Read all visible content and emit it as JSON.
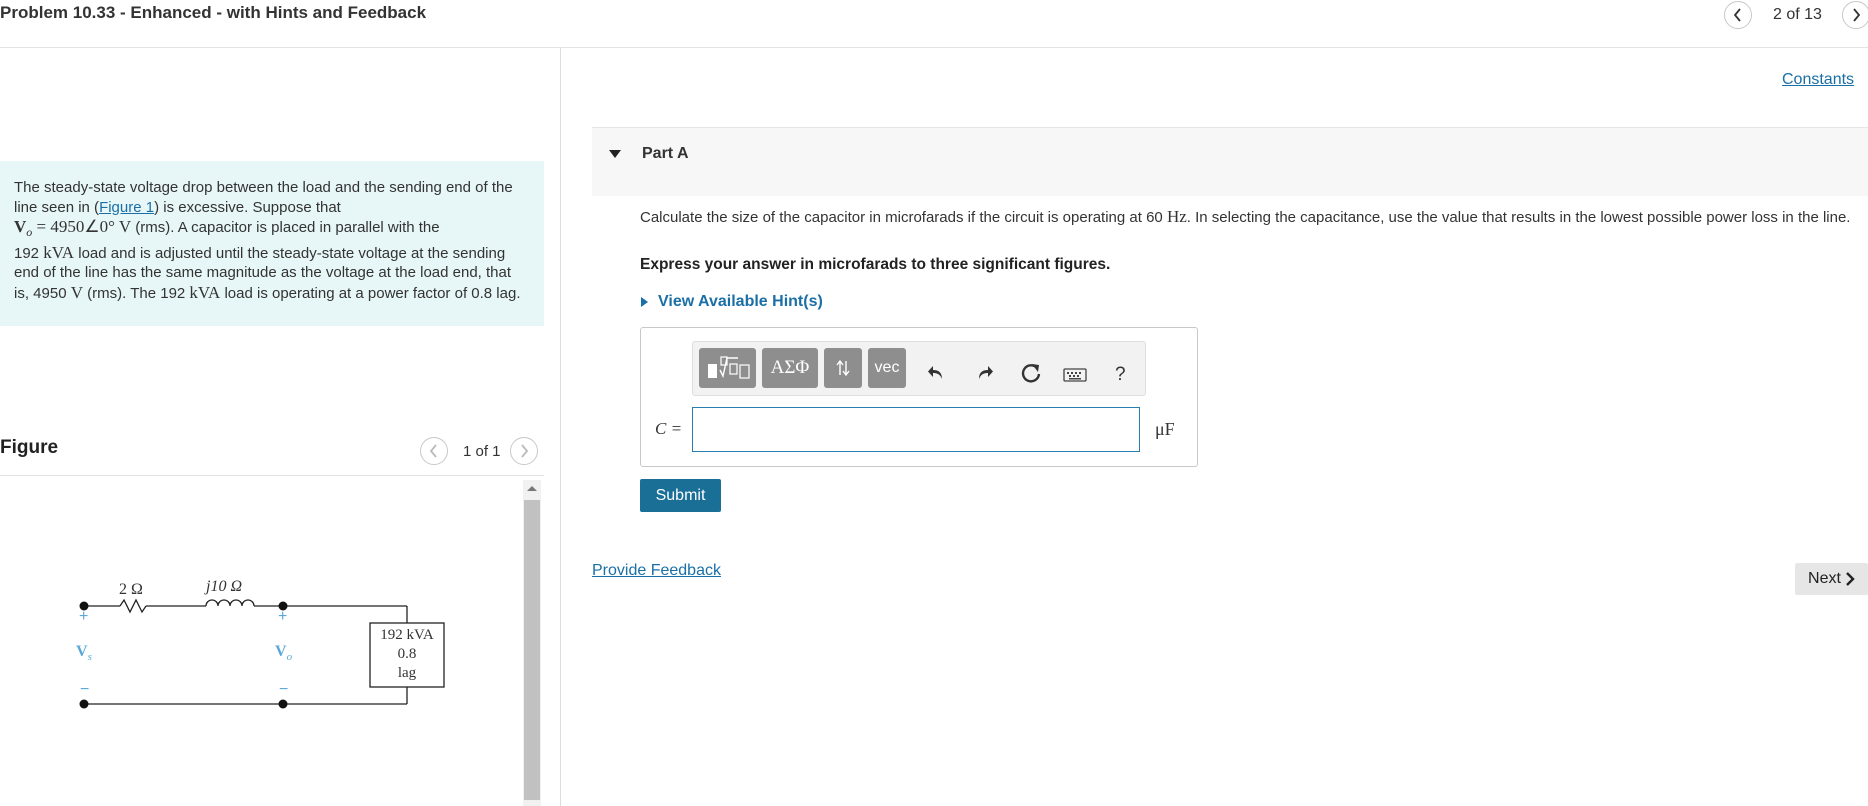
{
  "header": {
    "title": "Problem 10.33 - Enhanced - with Hints and Feedback",
    "pager": "2 of 13"
  },
  "problem": {
    "text_1": "The steady-state voltage drop between the load and the sending end of the line seen in (",
    "figure_link": "Figure 1",
    "text_2": ") is excessive. Suppose that",
    "v_symbol": "V",
    "v_sub": "o",
    "v_equals": " = 4950∠0° ",
    "v_unit": "V",
    "text_3": " (rms). A capacitor is placed in parallel with the",
    "load_value": "192",
    "load_unit": "kVA",
    "text_4": " load and is adjusted until the steady-state voltage at the sending end of the line has the same magnitude as the voltage at the load end, that is, 4950 ",
    "text_5": " (rms). The 192 ",
    "text_6": " load is operating at a power factor of 0.8 lag."
  },
  "figure": {
    "label": "Figure",
    "pager": "1 of 1",
    "r_label": "2 Ω",
    "x_label": "j10 Ω",
    "vs_label": "V",
    "vs_sub": "s",
    "vo_label": "V",
    "vo_sub": "o",
    "plus": "+",
    "minus": "−",
    "load_line1": "192 kVA",
    "load_line2": "0.8",
    "load_line3": "lag"
  },
  "right": {
    "constants_link": "Constants",
    "part_label": "Part A",
    "question_1": "Calculate the size of the capacitor in microfarads if the circuit is operating at 60 ",
    "question_unit": "Hz",
    "question_2": ". In selecting the capacitance, use the value that results in the lowest possible power loss in the line.",
    "express": "Express your answer in microfarads to three significant figures.",
    "hints_label": "View Available Hint(s)",
    "toolbar": {
      "greek_label": "ΑΣΦ",
      "vec_label": "vec",
      "help_label": "?"
    },
    "answer": {
      "variable": "C =",
      "value": "",
      "unit": "μF"
    },
    "submit_label": "Submit",
    "feedback_link": "Provide Feedback",
    "next_label": "Next"
  },
  "colors": {
    "link": "#1a6fa6",
    "submit_bg": "#1a6f97",
    "problem_bg": "#e7f6f7",
    "circuit_blue": "#5aa8d8"
  }
}
